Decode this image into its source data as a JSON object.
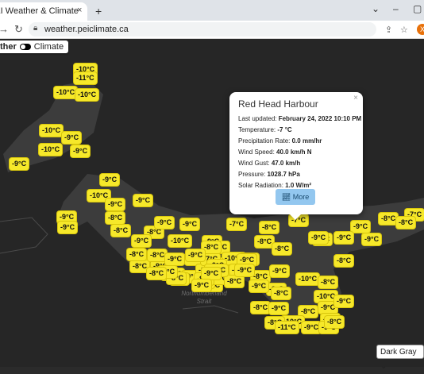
{
  "browser": {
    "tab_title": "PEI Weather & Climate",
    "tab_close": "×",
    "new_tab": "+",
    "url": "weather.peiclimate.ca",
    "win_minimize": "–",
    "win_maximize": "▢",
    "win_tabsearch": "⌄",
    "avatar_letter": "X"
  },
  "mode_toggle": {
    "left_label": "ther",
    "right_label": "Climate"
  },
  "popup": {
    "title": "Red Head Harbour",
    "close": "×",
    "last_updated_label": "Last updated:",
    "last_updated_value": "February 24, 2022 10:10 PM",
    "temperature_label": "Temperature:",
    "temperature_value": "-7 °C",
    "precip_label": "Precipitation Rate:",
    "precip_value": "0.0 mm/hr",
    "wind_speed_label": "Wind Speed:",
    "wind_speed_value": "40.0 km/h N",
    "wind_gust_label": "Wind Gust:",
    "wind_gust_value": "47.0 km/h",
    "pressure_label": "Pressure:",
    "pressure_value": "1028.7 hPa",
    "solar_label": "Solar Radiation:",
    "solar_value": "1.0 W/m²",
    "more_label": "More"
  },
  "water_label": "Northumberland Strait",
  "basemap_select": "Dark Gray",
  "temperature_tags": [
    "-10°C",
    "-11°C",
    "-10°C",
    "-10°C",
    "-10°C",
    "-9°C",
    "-10°C",
    "-9°C",
    "-9°C",
    "-9°C",
    "-10°C",
    "-9°C",
    "-9°C",
    "-9°C",
    "-8°C",
    "-9°C",
    "-8°C",
    "-8°C",
    "-9°C",
    "-9°C",
    "-9°C",
    "-7°C",
    "-8°C",
    "-7°C",
    "-7°C",
    "-8°C",
    "-8°C",
    "-9°C",
    "-9°C",
    "-9°C",
    "-10°C",
    "-9°C",
    "-8°C",
    "-9°C",
    "-8°C",
    "-10°C",
    "-10°C",
    "-9°C",
    "-8°C",
    "-9°C",
    "-8°C",
    "-8°C",
    "-10°C",
    "-9°C",
    "-9°C",
    "-9°C",
    "-8°C",
    "-8°C",
    "-9°C",
    "-10°C",
    "-8°C",
    "-9°C",
    "-9°C",
    "-8°C",
    "-9°C",
    "-9°C",
    "-9°C",
    "-8°C",
    "-8°C",
    "-9°C",
    "-10°C",
    "-8°C",
    "-8°C",
    "-9°C",
    "-8°C",
    "-9°C",
    "-10°C",
    "-9°C",
    "-9°C",
    "-8°C",
    "-11°C",
    "-9°C",
    "-9°C",
    "-8°C",
    "-9°C",
    "-8°C",
    "-8°C",
    "-8°C",
    "-9°C",
    "-9°C",
    "-8°C",
    "-7°C",
    "-8°C",
    "-9°C",
    "-8°C",
    "-9°C",
    "-10°C",
    "-9°C",
    "-8°C",
    "-9°C",
    "-9°C",
    "-9°C"
  ]
}
